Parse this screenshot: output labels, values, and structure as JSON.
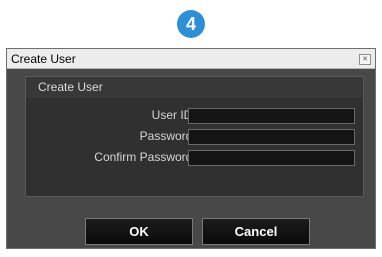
{
  "step_badge": "4",
  "dialog": {
    "title": "Create User",
    "close_icon": "close-icon"
  },
  "group": {
    "title": "Create User",
    "fields": [
      {
        "label": "User ID :",
        "value": ""
      },
      {
        "label": "Password :",
        "value": ""
      },
      {
        "label": "Confirm Password :",
        "value": ""
      }
    ]
  },
  "buttons": {
    "ok": "OK",
    "cancel": "Cancel"
  },
  "colors": {
    "badge": "#2e8fd6",
    "dialog_bg": "#484848",
    "group_bg": "#303030",
    "input_bg": "#141414",
    "button_bg": "#0a0a0a"
  }
}
